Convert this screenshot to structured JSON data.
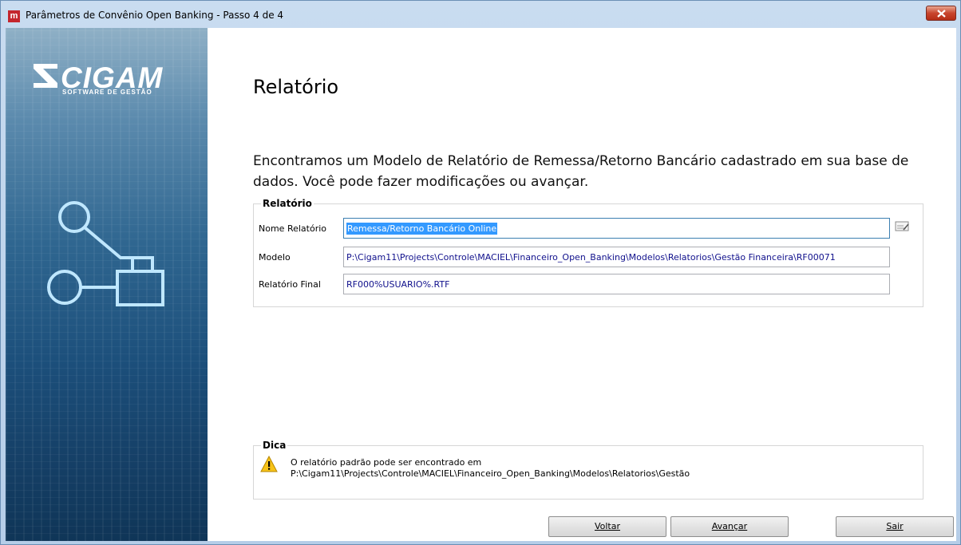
{
  "window": {
    "title": "Parâmetros de Convênio Open Banking - Passo 4 de 4",
    "app_icon_letter": "m"
  },
  "sidebar": {
    "logo_text": "CIGAM",
    "logo_subtext": "SOFTWARE DE GESTÃO"
  },
  "page": {
    "heading": "Relatório",
    "description": "Encontramos um Modelo de Relatório de Remessa/Retorno Bancário cadastrado em sua base de dados. Você pode fazer modificações ou avançar."
  },
  "report_group": {
    "title": "Relatório",
    "nome_label": "Nome Relatório",
    "nome_value": "Remessa/Retorno Bancário Online",
    "modelo_label": "Modelo",
    "modelo_value": "P:\\Cigam11\\Projects\\Controle\\MACIEL\\Financeiro_Open_Banking\\Modelos\\Relatorios\\Gestão Financeira\\RF00071",
    "final_label": "Relatório Final",
    "final_value": "RF000%USUARIO%.RTF"
  },
  "tip_group": {
    "title": "Dica",
    "line1": "O relatório padrão pode ser encontrado em",
    "line2": "P:\\Cigam11\\Projects\\Controle\\MACIEL\\Financeiro_Open_Banking\\Modelos\\Relatorios\\Gestão"
  },
  "buttons": {
    "back": "Voltar",
    "next": "Avançar",
    "exit": "Sair"
  },
  "colors": {
    "field_text": "#10108c",
    "selection": "#3399ff",
    "sidebar_blue": "#1c4f7b"
  }
}
